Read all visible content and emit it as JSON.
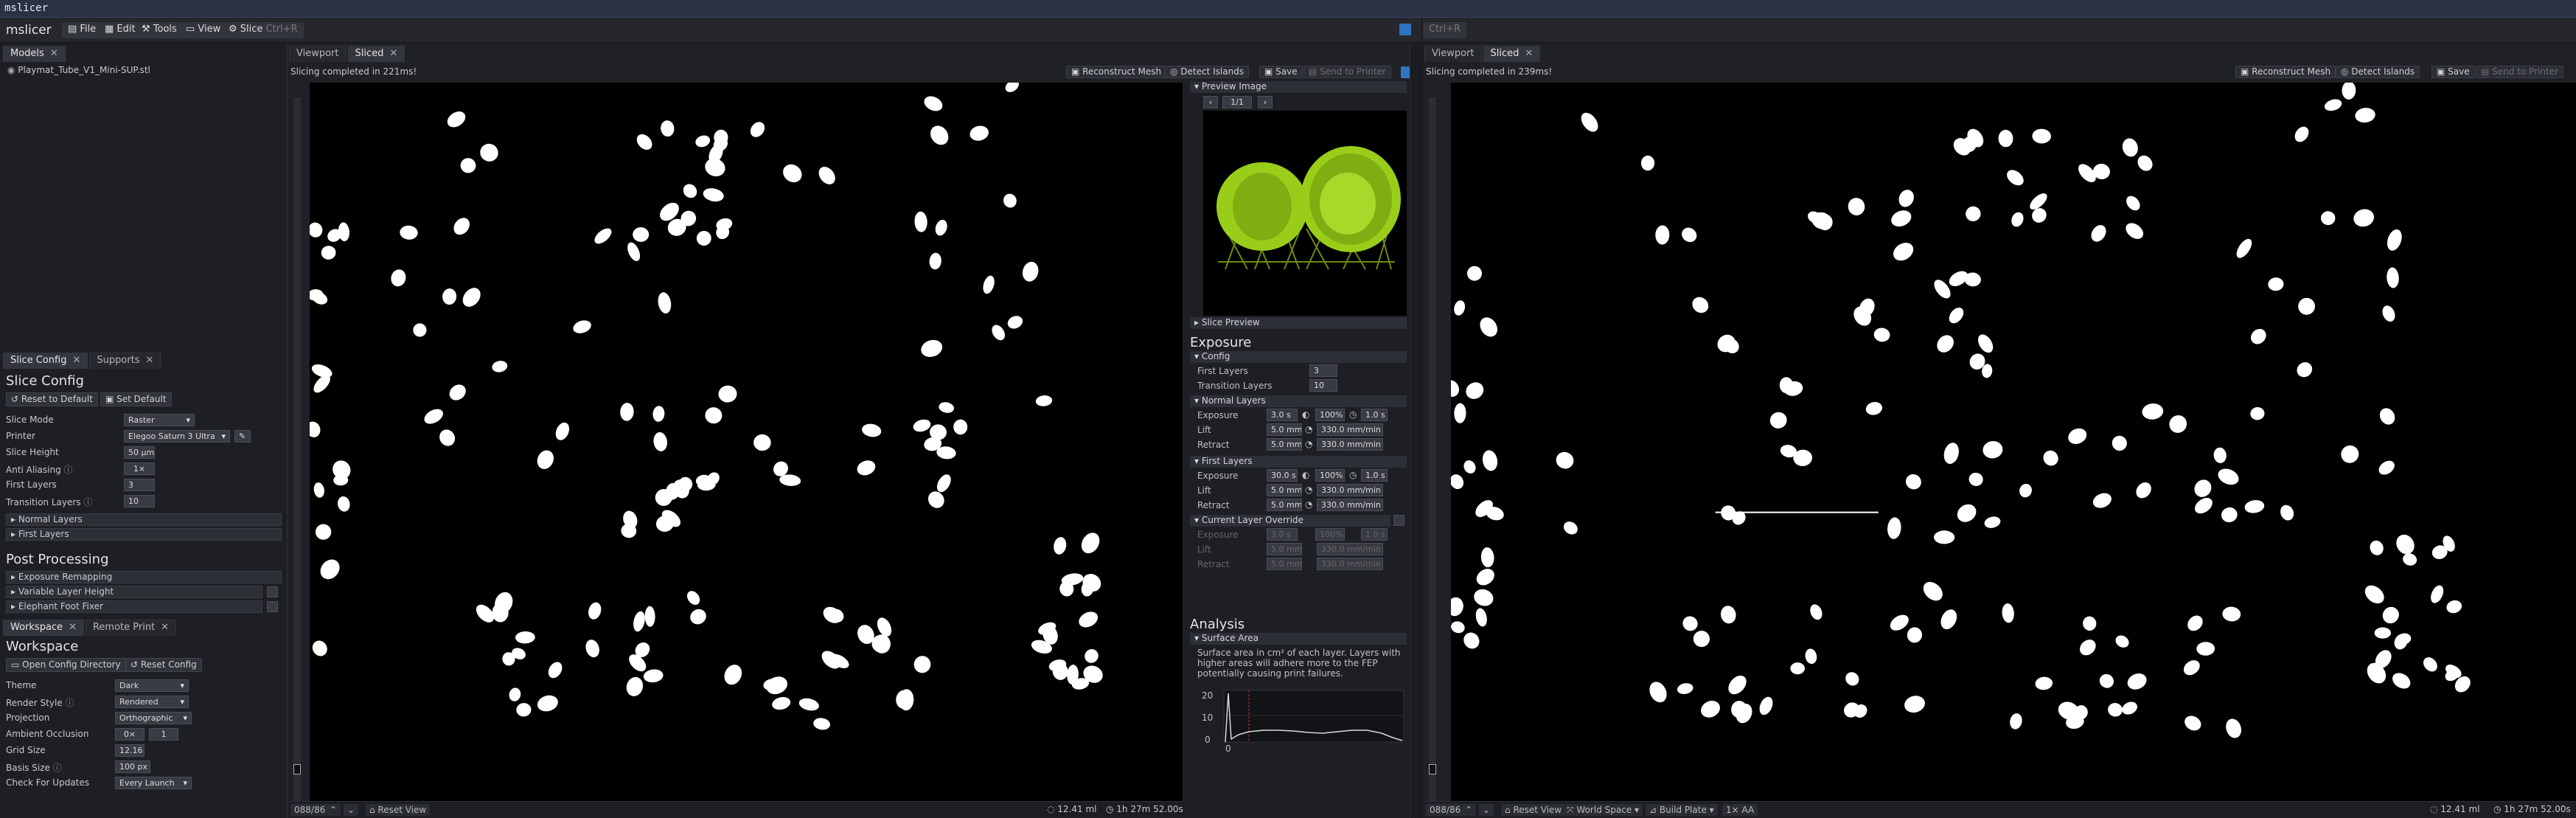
{
  "app_title": "mslicer",
  "menu": {
    "app_name": "mslicer",
    "file": "File",
    "edit": "Edit",
    "tools": "Tools",
    "view": "View",
    "slice": "Slice",
    "slice_shortcut": "Ctrl+R",
    "right_app_name": "Ctrl+R"
  },
  "left": {
    "models_tab": "Models",
    "model_item": "Playmat_Tube_V1_Mini-SUP.stl",
    "slice_config_tab": "Slice Config",
    "supports_tab": "Supports",
    "slice_config_title": "Slice Config",
    "reset_default": "Reset to Default",
    "set_default": "Set Default",
    "slice_mode_label": "Slice Mode",
    "slice_mode_value": "Raster",
    "printer_label": "Printer",
    "printer_value": "Elegoo Saturn 3 Ultra",
    "slice_height_label": "Slice Height",
    "slice_height_value": "50 µm",
    "anti_aliasing_label": "Anti Aliasing",
    "anti_aliasing_value": "1×",
    "first_layers_label": "First Layers",
    "first_layers_value": "3",
    "transition_layers_label": "Transition Layers",
    "transition_layers_value": "10",
    "normal_layers": "Normal Layers",
    "first_layers_section": "First Layers",
    "post_processing_title": "Post Processing",
    "exposure_remapping": "Exposure Remapping",
    "variable_layer_height": "Variable Layer Height",
    "elephant_foot_fixer": "Elephant Foot Fixer",
    "workspace_tab": "Workspace",
    "remote_print_tab": "Remote Print",
    "workspace_title": "Workspace",
    "open_config_dir": "Open Config Directory",
    "reset_config": "Reset Config",
    "theme_label": "Theme",
    "theme_value": "Dark",
    "render_style_label": "Render Style",
    "render_style_value": "Rendered",
    "projection_label": "Projection",
    "projection_value": "Orthographic",
    "ambient_occlusion_label": "Ambient Occlusion",
    "ao_value1": "0×",
    "ao_value2": "1",
    "grid_size_label": "Grid Size",
    "grid_size_value": "12.16",
    "basis_size_label": "Basis Size",
    "basis_size_value": "100 px",
    "check_updates_label": "Check For Updates",
    "check_updates_value": "Every Launch"
  },
  "center": {
    "viewport_tab": "Viewport",
    "sliced_tab": "Sliced",
    "status": "Slicing completed in 221ms!",
    "reconstruct_mesh": "Reconstruct Mesh",
    "detect_islands": "Detect Islands",
    "save": "Save",
    "send_to_printer": "Send to Printer",
    "layer_counter": "088/869",
    "reset_view": "Reset View",
    "volume": "12.41 ml",
    "print_time": "1h 27m 52.00s"
  },
  "right_panel": {
    "preview_image": "Preview Image",
    "preview_page": "1/1",
    "slice_preview": "Slice Preview",
    "exposure_title": "Exposure",
    "config": "Config",
    "first_layers_label": "First Layers",
    "first_layers_value": "3",
    "transition_layers_label": "Transition Layers",
    "transition_layers_value": "10",
    "normal_layers": "Normal Layers",
    "exposure_label": "Exposure",
    "lift_label": "Lift",
    "retract_label": "Retract",
    "nl_exposure": "3.0 s",
    "nl_pct": "100%",
    "nl_wait": "1.0 s",
    "nl_lift": "5.0 mm",
    "nl_lift_speed": "330.0 mm/min",
    "nl_retract": "5.0 mm",
    "nl_retract_speed": "330.0 mm/min",
    "first_layers_section": "First Layers",
    "fl_exposure": "30.0 s",
    "fl_pct": "100%",
    "fl_wait": "1.0 s",
    "fl_lift": "5.0 mm",
    "fl_lift_speed": "330.0 mm/min",
    "fl_retract": "5.0 mm",
    "fl_retract_speed": "330.0 mm/min",
    "current_layer_override": "Current Layer Override",
    "co_exposure": "3.0 s",
    "co_pct": "100%",
    "co_wait": "1.0 s",
    "co_lift": "5.0 mm",
    "co_lift_speed": "330.0 mm/min",
    "co_retract": "5.0 mm",
    "co_retract_speed": "330.0 mm/min",
    "analysis_title": "Analysis",
    "surface_area": "Surface Area",
    "surface_desc": "Surface area in cm² of each layer. Layers with higher areas will adhere more to the FEP potentially causing print failures.",
    "chart_y_ticks": [
      "20",
      "10",
      "0"
    ],
    "chart_x_tick": "0"
  },
  "right_window": {
    "viewport_tab": "Viewport",
    "sliced_tab": "Sliced",
    "status": "Slicing completed in 239ms!",
    "reconstruct_mesh": "Reconstruct Mesh",
    "detect_islands": "Detect Islands",
    "save": "Save",
    "send_to_printer": "Send to Printer",
    "layer_counter": "088/869",
    "reset_view": "Reset View",
    "world_space": "World Space",
    "build_plate": "Build Plate",
    "aa": "1× AA",
    "volume": "12.41 ml",
    "print_time": "1h 27m 52.00s"
  },
  "colors": {
    "accent": "#2f74c0",
    "preview_green": "#9acd1a",
    "chart_red": "#c83030"
  }
}
